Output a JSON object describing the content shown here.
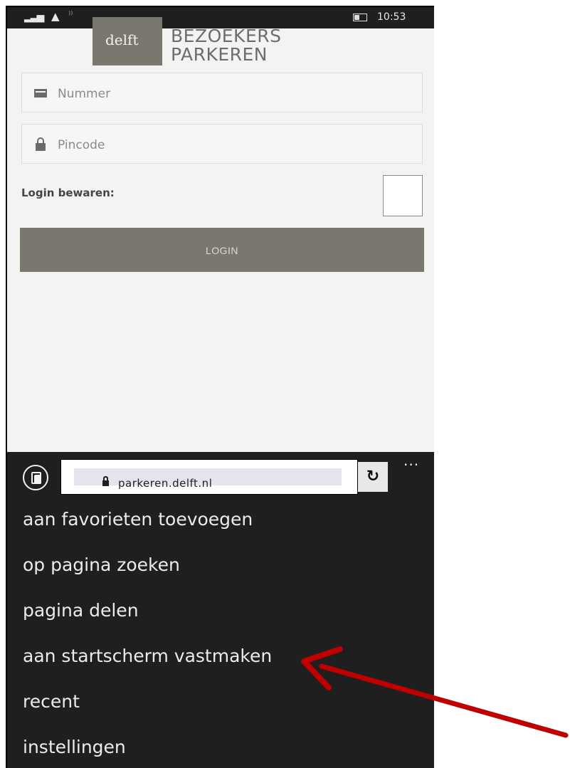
{
  "status_bar": {
    "signal_icon": "signal-bars-icon",
    "network_icon": "network-triangle-icon",
    "wifi_icon": "wifi-icon",
    "battery_icon": "battery-icon",
    "time": "10:53"
  },
  "header": {
    "logo_text": "delft",
    "logo_sub": "",
    "title_line1": "BEZOEKERS",
    "title_line2": "PARKEREN"
  },
  "form": {
    "number_placeholder": "Nummer",
    "number_icon": "card-icon",
    "pin_placeholder": "Pincode",
    "pin_icon": "lock-icon",
    "remember_label": "Login bewaren:",
    "remember_checked": false,
    "login_label": "LOGIN"
  },
  "browser": {
    "tabs_icon": "tabs-icon",
    "url": "parkeren.delft.nl",
    "secure_icon": "lock-icon",
    "refresh_icon": "refresh-icon",
    "refresh_glyph": "↻",
    "more_label": "...",
    "menu_items": [
      "aan favorieten toevoegen",
      "op pagina zoeken",
      "pagina delen",
      "aan startscherm vastmaken",
      "recent",
      "instellingen"
    ]
  },
  "annotation": {
    "arrow_color": "#c00000",
    "points_to": "aan startscherm vastmaken"
  }
}
